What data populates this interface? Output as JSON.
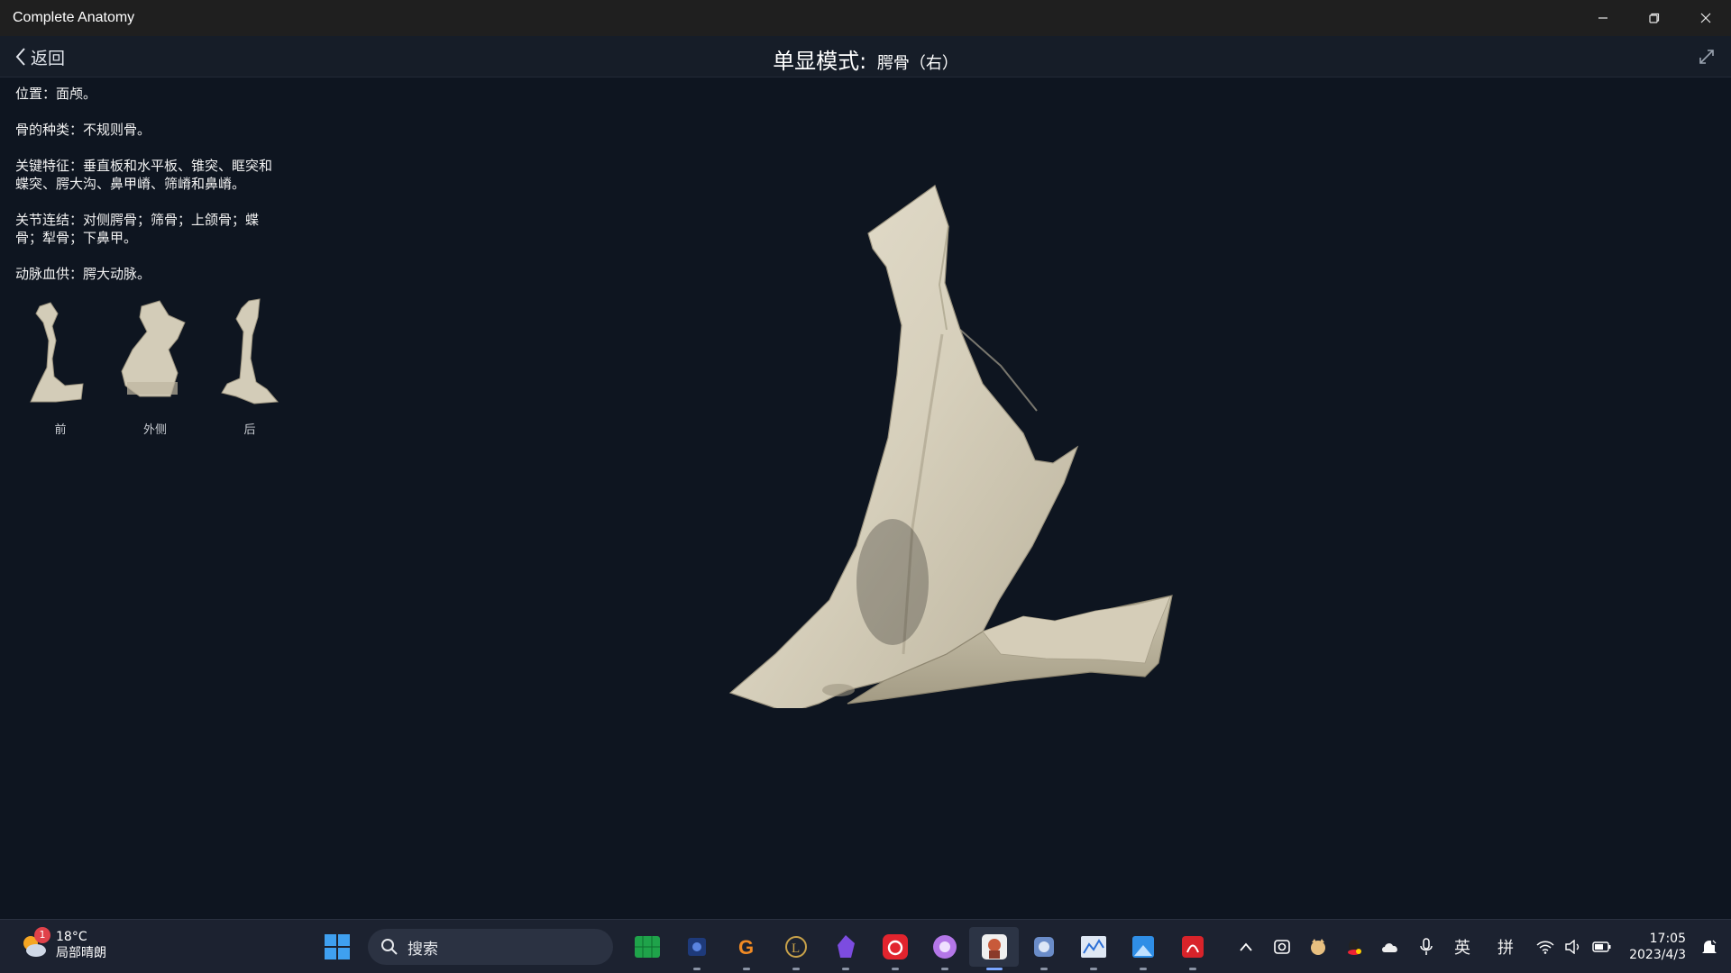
{
  "window": {
    "title": "Complete Anatomy"
  },
  "header": {
    "back_label": "返回",
    "mode_label": "单显模式:",
    "bone_name": "腭骨（右）"
  },
  "info": {
    "location": "位置：面颅。",
    "bone_type": "骨的种类：不规则骨。",
    "key_features": "关键特征：垂直板和水平板、锥突、眶突和蝶突、腭大沟、鼻甲嵴、筛嵴和鼻嵴。",
    "articulations": "关节连结：对侧腭骨；筛骨；上颌骨；蝶骨；犁骨；下鼻甲。",
    "blood_supply": "动脉血供：腭大动脉。"
  },
  "views": [
    {
      "label": "前"
    },
    {
      "label": "外侧"
    },
    {
      "label": "后"
    }
  ],
  "taskbar": {
    "weather_temp": "18°C",
    "weather_desc": "局部晴朗",
    "weather_badge": "1",
    "search_placeholder": "搜索",
    "ime_lang": "英",
    "ime_mode": "拼",
    "time": "17:05",
    "date": "2023/4/3"
  },
  "colors": {
    "background": "#0e1520",
    "bone": "#d9d3c2",
    "titlebar": "#1f1f1f",
    "taskbar": "#1c2230"
  }
}
